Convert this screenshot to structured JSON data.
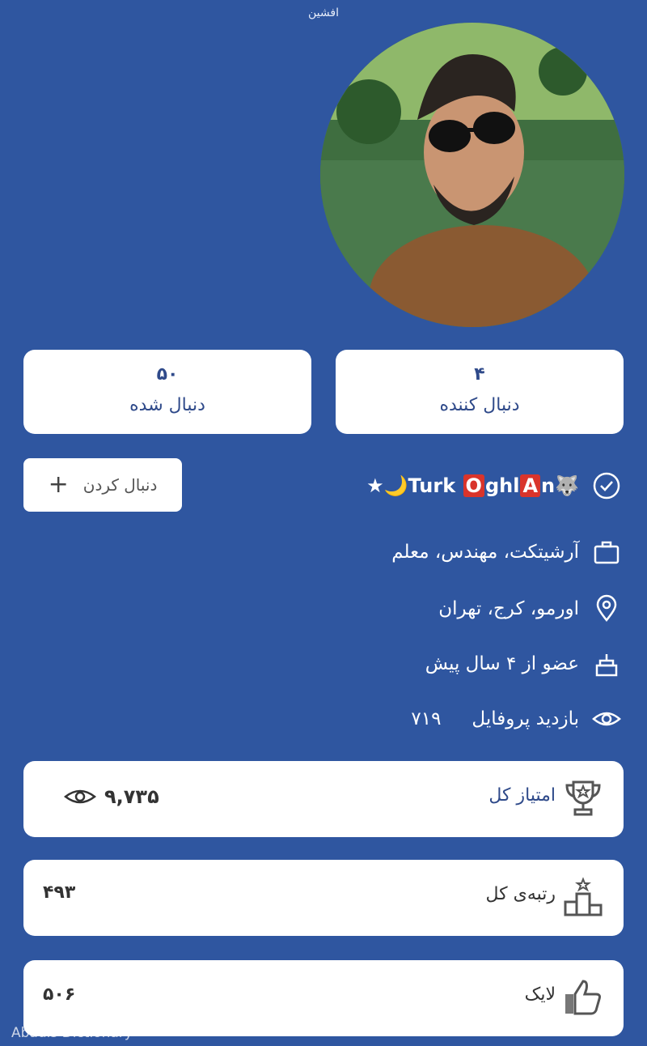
{
  "header": {
    "title": "افشین"
  },
  "stats": {
    "followers": {
      "count": "۴",
      "label": "دنبال کننده"
    },
    "following": {
      "count": "۵۰",
      "label": "دنبال شده"
    }
  },
  "follow_button": {
    "label": "دنبال کردن",
    "icon": "plus-icon"
  },
  "profile": {
    "name_parts": [
      "Turk ",
      "O",
      "ghl",
      "A",
      "n"
    ],
    "name_prefix": "★🌙",
    "name_suffix": "🐺",
    "name_icon": "verified-check-icon",
    "job": "آرشیتکت، مهندس، معلم",
    "job_icon": "briefcase-icon",
    "location": "اورمو، کرج، تهران",
    "location_icon": "location-pin-icon",
    "member_since": "عضو از ۴ سال پیش",
    "member_icon": "birthday-cake-icon",
    "views_label": "بازدید پروفایل",
    "views_value": "۷۱۹",
    "views_icon": "eye-icon"
  },
  "cards": {
    "score": {
      "label": "امتیاز کل",
      "value": "۹,۷۳۵",
      "icon": "trophy-icon",
      "value_icon": "eye-icon"
    },
    "rank": {
      "label": "رتبه‌ی کل",
      "value": "۴۹۳",
      "icon": "podium-icon"
    },
    "like": {
      "label": "لایک",
      "value": "۵۰۶",
      "icon": "thumbs-up-icon"
    }
  },
  "watermark": "Abadis Dictionary",
  "colors": {
    "background": "#2f56a0",
    "card": "#ffffff",
    "accent_text": "#2f4a8a",
    "name_box": "#d9342b"
  }
}
